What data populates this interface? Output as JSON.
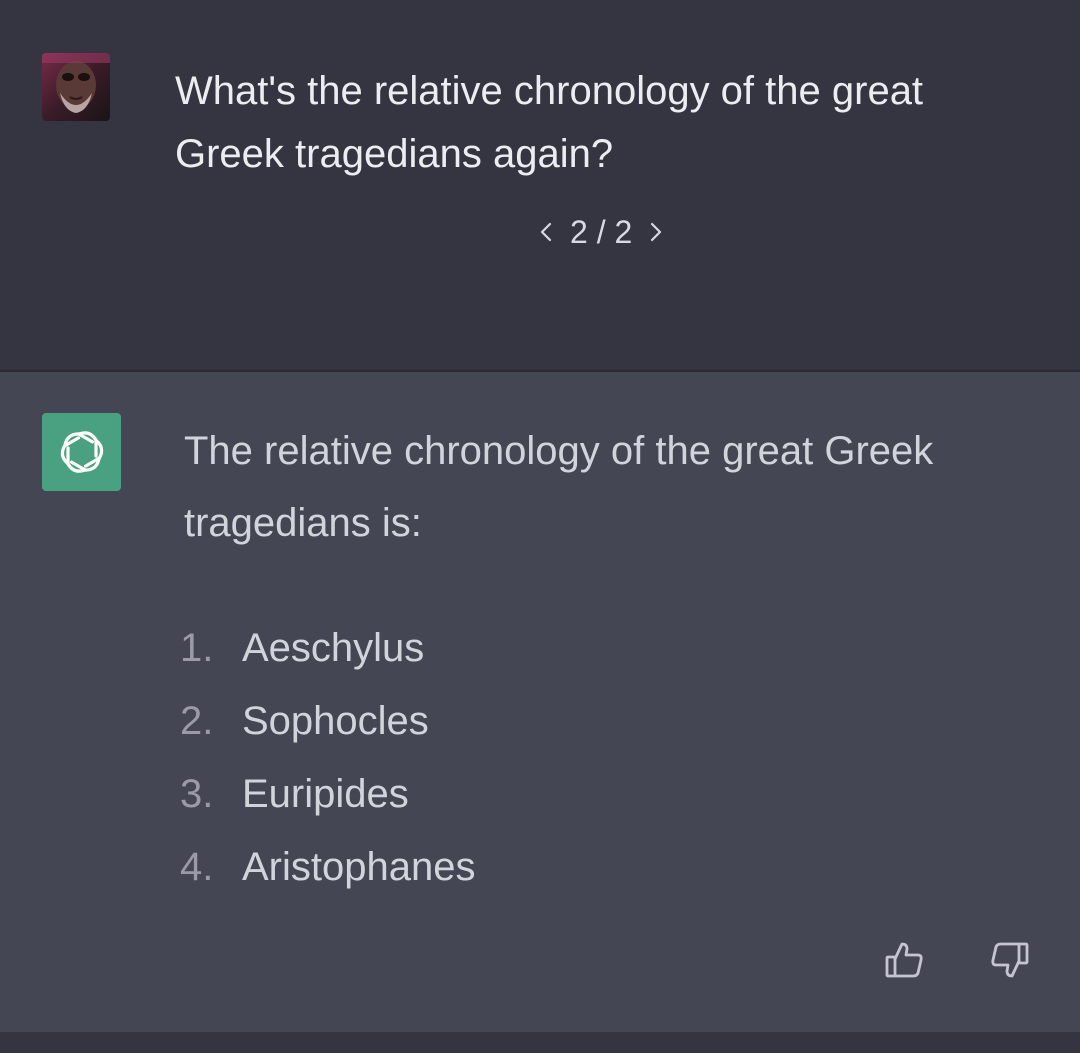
{
  "user_message": {
    "text": "What's the relative chronology of the great Greek tragedians again?",
    "pager": {
      "current": "2",
      "separator": "/",
      "total": "2"
    }
  },
  "assistant_message": {
    "intro": "The relative chronology of the great Greek tragedians is:",
    "items": [
      {
        "num": "1.",
        "label": "Aeschylus"
      },
      {
        "num": "2.",
        "label": "Sophocles"
      },
      {
        "num": "3.",
        "label": "Euripides"
      },
      {
        "num": "4.",
        "label": "Aristophanes"
      }
    ]
  },
  "icons": {
    "prev": "chevron-left-icon",
    "next": "chevron-right-icon",
    "thumbs_up": "thumbs-up-icon",
    "thumbs_down": "thumbs-down-icon",
    "assistant_logo": "openai-logo-icon"
  },
  "colors": {
    "user_bg": "#343541",
    "assistant_bg": "#444654",
    "logo_bg": "#4aa181",
    "text": "#ececf1",
    "muted": "#9a9ba6"
  }
}
